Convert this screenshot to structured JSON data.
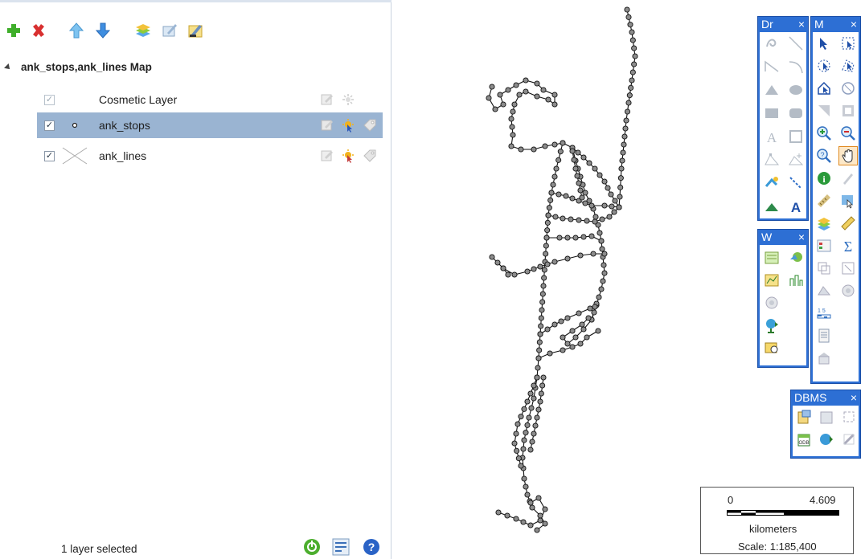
{
  "layer_panel": {
    "map_title": "ank_stops,ank_lines Map",
    "layers": [
      {
        "name": "Cosmetic Layer",
        "checked": true,
        "disabled": true,
        "selected": false,
        "symbol": "none"
      },
      {
        "name": "ank_stops",
        "checked": true,
        "disabled": false,
        "selected": true,
        "symbol": "point"
      },
      {
        "name": "ank_lines",
        "checked": true,
        "disabled": false,
        "selected": false,
        "symbol": "line"
      }
    ],
    "status_text": "1 layer selected"
  },
  "palettes": {
    "drawing": {
      "title": "Dr",
      "close": "×"
    },
    "main": {
      "title": "M",
      "close": "×"
    },
    "windows": {
      "title": "W",
      "close": "×"
    },
    "dbms": {
      "title": "DBMS",
      "close": "×"
    }
  },
  "scale_bar": {
    "min_label": "0",
    "max_label": "4.609",
    "unit": "kilometers",
    "scale_text": "Scale: 1:185,400"
  },
  "colors": {
    "palette_blue": "#2d6fd4",
    "selection": "#9ab4d2",
    "map_node": "#8c8c8c"
  }
}
